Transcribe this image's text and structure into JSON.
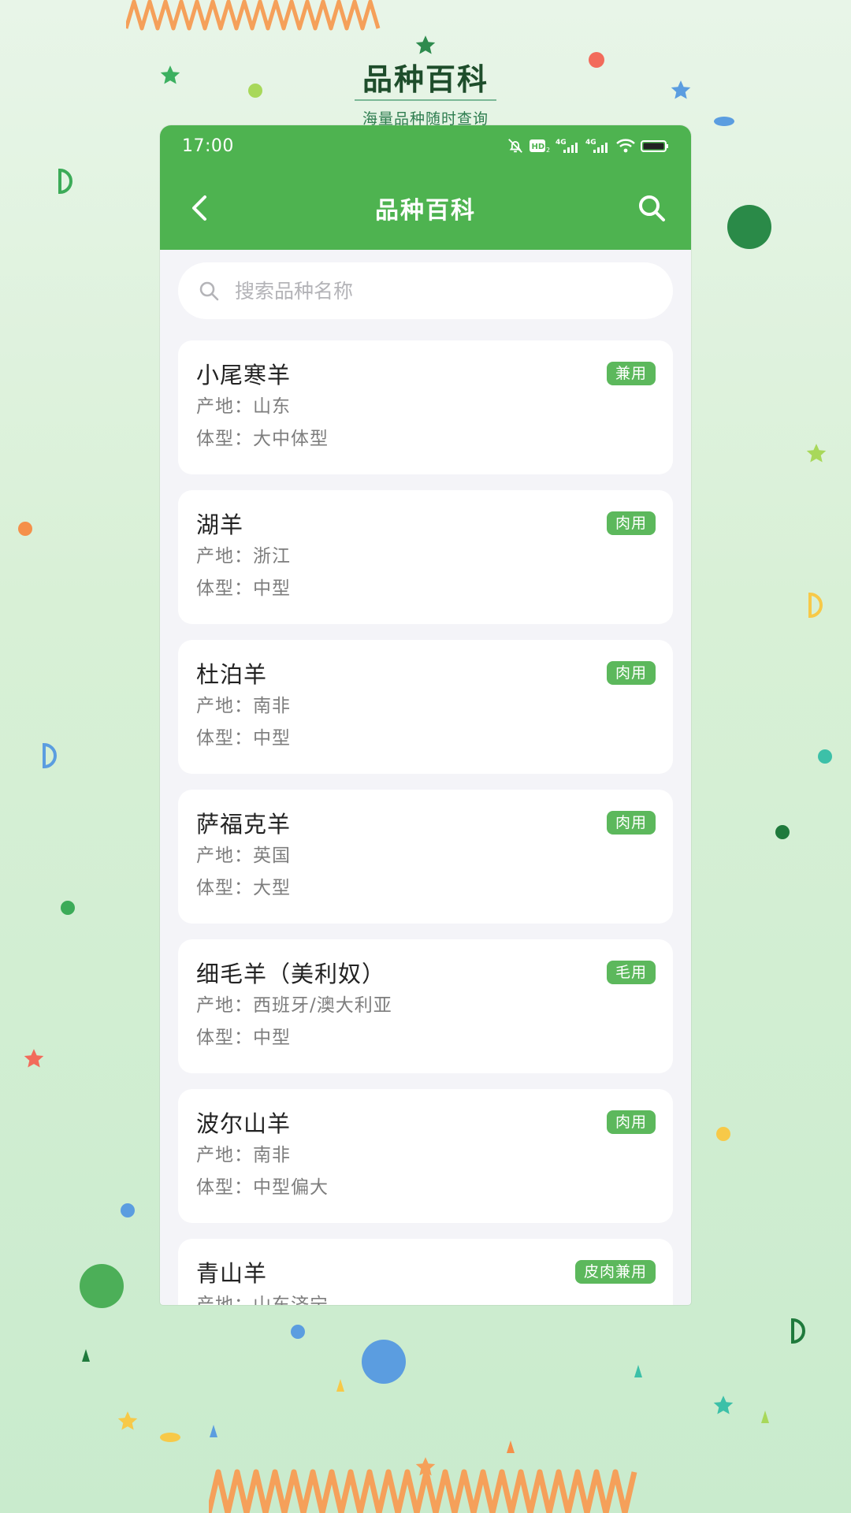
{
  "promo": {
    "title": "品种百科",
    "subtitle": "海量品种随时查询"
  },
  "status_bar": {
    "time": "17:00"
  },
  "nav": {
    "title": "品种百科"
  },
  "search": {
    "placeholder": "搜索品种名称",
    "value": ""
  },
  "labels": {
    "origin": "产地：",
    "body": "体型："
  },
  "colors": {
    "primary": "#4eb350",
    "tag": "#5cb85c",
    "page_bg": "#f4f4f8"
  },
  "breeds": [
    {
      "name": "小尾寒羊",
      "tag": "兼用",
      "origin": "山东",
      "body": "大中体型"
    },
    {
      "name": "湖羊",
      "tag": "肉用",
      "origin": "浙江",
      "body": "中型"
    },
    {
      "name": "杜泊羊",
      "tag": "肉用",
      "origin": "南非",
      "body": "中型"
    },
    {
      "name": "萨福克羊",
      "tag": "肉用",
      "origin": "英国",
      "body": "大型"
    },
    {
      "name": "细毛羊（美利奴）",
      "tag": "毛用",
      "origin": "西班牙/澳大利亚",
      "body": "中型"
    },
    {
      "name": "波尔山羊",
      "tag": "肉用",
      "origin": "南非",
      "body": "中型偏大"
    },
    {
      "name": "青山羊",
      "tag": "皮肉兼用",
      "origin": "山东济宁",
      "body": ""
    }
  ]
}
